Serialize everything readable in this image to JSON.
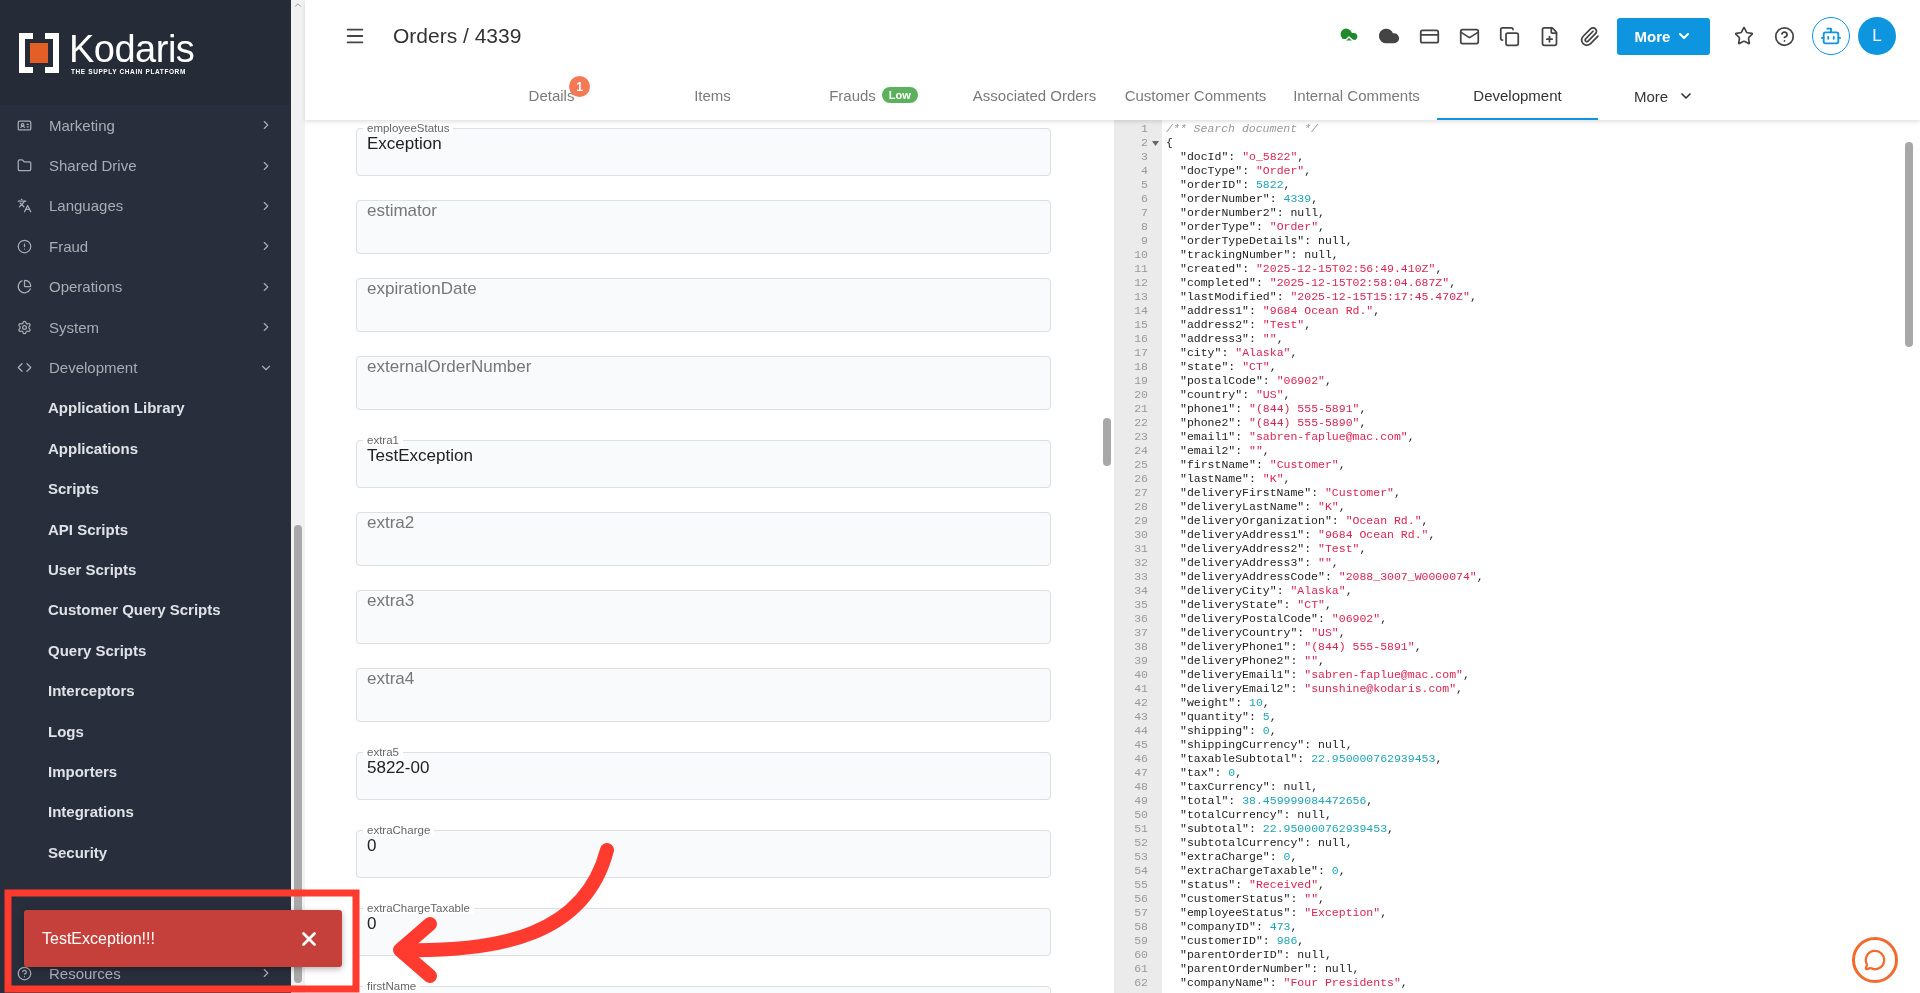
{
  "sidebar": {
    "logo": {
      "name": "Kodaris",
      "tagline": "THE SUPPLY CHAIN PLATFORM"
    },
    "items": [
      {
        "label": "Marketing",
        "expanded": false
      },
      {
        "label": "Shared Drive",
        "expanded": false
      },
      {
        "label": "Languages",
        "expanded": false
      },
      {
        "label": "Fraud",
        "expanded": false
      },
      {
        "label": "Operations",
        "expanded": false
      },
      {
        "label": "System",
        "expanded": false
      },
      {
        "label": "Development",
        "expanded": true,
        "children": [
          {
            "label": "Application Library"
          },
          {
            "label": "Applications"
          },
          {
            "label": "Scripts"
          },
          {
            "label": "API Scripts"
          },
          {
            "label": "User Scripts"
          },
          {
            "label": "Customer Query Scripts"
          },
          {
            "label": "Query Scripts"
          },
          {
            "label": "Interceptors"
          },
          {
            "label": "Logs"
          },
          {
            "label": "Importers"
          },
          {
            "label": "Integrations"
          },
          {
            "label": "Security"
          }
        ]
      },
      {
        "label": "Resources",
        "expanded": false
      }
    ]
  },
  "header": {
    "title": "Orders / 4339",
    "more_button": "More",
    "avatar": "L"
  },
  "tabs": [
    {
      "label": "Details",
      "selected": false,
      "badge": "1"
    },
    {
      "label": "Items",
      "selected": false
    },
    {
      "label": "Frauds",
      "selected": false,
      "tag": "Low"
    },
    {
      "label": "Associated Orders",
      "selected": false
    },
    {
      "label": "Customer Comments",
      "selected": false
    },
    {
      "label": "Internal Comments",
      "selected": false
    },
    {
      "label": "Development",
      "selected": true
    }
  ],
  "tabs_more": "More",
  "fields": [
    {
      "label": "employeeStatus",
      "value": "Exception"
    },
    {
      "placeholder": "estimator"
    },
    {
      "placeholder": "expirationDate"
    },
    {
      "placeholder": "externalOrderNumber"
    },
    {
      "label": "extra1",
      "value": "TestException"
    },
    {
      "placeholder": "extra2"
    },
    {
      "placeholder": "extra3"
    },
    {
      "placeholder": "extra4"
    },
    {
      "label": "extra5",
      "value": "5822-00"
    },
    {
      "label": "extraCharge",
      "value": "0"
    },
    {
      "label": "extraChargeTaxable",
      "value": "0"
    },
    {
      "label": "firstName"
    }
  ],
  "code_lines": [
    {
      "n": "1",
      "kind": "comment",
      "text": "/** Search document */"
    },
    {
      "n": "2",
      "kind": "brace",
      "text": "{",
      "foldable": true
    },
    {
      "n": "3",
      "kind": "pair",
      "text": "\"docId\": \"o_5822\","
    },
    {
      "n": "4",
      "kind": "pair",
      "text": "\"docType\": \"Order\","
    },
    {
      "n": "5",
      "kind": "pair",
      "text": "\"orderID\": 5822,"
    },
    {
      "n": "6",
      "kind": "pair",
      "text": "\"orderNumber\": 4339,"
    },
    {
      "n": "7",
      "kind": "pair",
      "text": "\"orderNumber2\": null,"
    },
    {
      "n": "8",
      "kind": "pair",
      "text": "\"orderType\": \"Order\","
    },
    {
      "n": "9",
      "kind": "pair",
      "text": "\"orderTypeDetails\": null,"
    },
    {
      "n": "10",
      "kind": "pair",
      "text": "\"trackingNumber\": null,"
    },
    {
      "n": "11",
      "kind": "pair",
      "text": "\"created\": \"2025-12-15T02:56:49.410Z\","
    },
    {
      "n": "12",
      "kind": "pair",
      "text": "\"completed\": \"2025-12-15T02:58:04.687Z\","
    },
    {
      "n": "13",
      "kind": "pair",
      "text": "\"lastModified\": \"2025-12-15T15:17:45.470Z\","
    },
    {
      "n": "14",
      "kind": "pair",
      "text": "\"address1\": \"9684 Ocean Rd.\","
    },
    {
      "n": "15",
      "kind": "pair",
      "text": "\"address2\": \"Test\","
    },
    {
      "n": "16",
      "kind": "pair",
      "text": "\"address3\": \"\","
    },
    {
      "n": "17",
      "kind": "pair",
      "text": "\"city\": \"Alaska\","
    },
    {
      "n": "18",
      "kind": "pair",
      "text": "\"state\": \"CT\","
    },
    {
      "n": "19",
      "kind": "pair",
      "text": "\"postalCode\": \"06902\","
    },
    {
      "n": "20",
      "kind": "pair",
      "text": "\"country\": \"US\","
    },
    {
      "n": "21",
      "kind": "pair",
      "text": "\"phone1\": \"(844) 555-5891\","
    },
    {
      "n": "22",
      "kind": "pair",
      "text": "\"phone2\": \"(844) 555-5890\","
    },
    {
      "n": "23",
      "kind": "pair",
      "text": "\"email1\": \"sabren-faplue@mac.com\","
    },
    {
      "n": "24",
      "kind": "pair",
      "text": "\"email2\": \"\","
    },
    {
      "n": "25",
      "kind": "pair",
      "text": "\"firstName\": \"Customer\","
    },
    {
      "n": "26",
      "kind": "pair",
      "text": "\"lastName\": \"K\","
    },
    {
      "n": "27",
      "kind": "pair",
      "text": "\"deliveryFirstName\": \"Customer\","
    },
    {
      "n": "28",
      "kind": "pair",
      "text": "\"deliveryLastName\": \"K\","
    },
    {
      "n": "29",
      "kind": "pair",
      "text": "\"deliveryOrganization\": \"Ocean Rd.\","
    },
    {
      "n": "30",
      "kind": "pair",
      "text": "\"deliveryAddress1\": \"9684 Ocean Rd.\","
    },
    {
      "n": "31",
      "kind": "pair",
      "text": "\"deliveryAddress2\": \"Test\","
    },
    {
      "n": "32",
      "kind": "pair",
      "text": "\"deliveryAddress3\": \"\","
    },
    {
      "n": "33",
      "kind": "pair",
      "text": "\"deliveryAddressCode\": \"2088_3007_W0000074\","
    },
    {
      "n": "34",
      "kind": "pair",
      "text": "\"deliveryCity\": \"Alaska\","
    },
    {
      "n": "35",
      "kind": "pair",
      "text": "\"deliveryState\": \"CT\","
    },
    {
      "n": "36",
      "kind": "pair",
      "text": "\"deliveryPostalCode\": \"06902\","
    },
    {
      "n": "37",
      "kind": "pair",
      "text": "\"deliveryCountry\": \"US\","
    },
    {
      "n": "38",
      "kind": "pair",
      "text": "\"deliveryPhone1\": \"(844) 555-5891\","
    },
    {
      "n": "39",
      "kind": "pair",
      "text": "\"deliveryPhone2\": \"\","
    },
    {
      "n": "40",
      "kind": "pair",
      "text": "\"deliveryEmail1\": \"sabren-faplue@mac.com\","
    },
    {
      "n": "41",
      "kind": "pair",
      "text": "\"deliveryEmail2\": \"sunshine@kodaris.com\","
    },
    {
      "n": "42",
      "kind": "pair",
      "text": "\"weight\": 10,"
    },
    {
      "n": "43",
      "kind": "pair",
      "text": "\"quantity\": 5,"
    },
    {
      "n": "44",
      "kind": "pair",
      "text": "\"shipping\": 0,"
    },
    {
      "n": "45",
      "kind": "pair",
      "text": "\"shippingCurrency\": null,"
    },
    {
      "n": "46",
      "kind": "pair",
      "text": "\"taxableSubtotal\": 22.950000762939453,"
    },
    {
      "n": "47",
      "kind": "pair",
      "text": "\"tax\": 0,"
    },
    {
      "n": "48",
      "kind": "pair",
      "text": "\"taxCurrency\": null,"
    },
    {
      "n": "49",
      "kind": "pair",
      "text": "\"total\": 38.459999084472656,"
    },
    {
      "n": "50",
      "kind": "pair",
      "text": "\"totalCurrency\": null,"
    },
    {
      "n": "51",
      "kind": "pair",
      "text": "\"subtotal\": 22.950000762939453,"
    },
    {
      "n": "52",
      "kind": "pair",
      "text": "\"subtotalCurrency\": null,"
    },
    {
      "n": "53",
      "kind": "pair",
      "text": "\"extraCharge\": 0,"
    },
    {
      "n": "54",
      "kind": "pair",
      "text": "\"extraChargeTaxable\": 0,"
    },
    {
      "n": "55",
      "kind": "pair",
      "text": "\"status\": \"Received\","
    },
    {
      "n": "56",
      "kind": "pair",
      "text": "\"customerStatus\": \"\","
    },
    {
      "n": "57",
      "kind": "pair",
      "text": "\"employeeStatus\": \"Exception\","
    },
    {
      "n": "58",
      "kind": "pair",
      "text": "\"companyID\": 473,"
    },
    {
      "n": "59",
      "kind": "pair",
      "text": "\"customerID\": 986,"
    },
    {
      "n": "60",
      "kind": "pair",
      "text": "\"parentOrderID\": null,"
    },
    {
      "n": "61",
      "kind": "pair",
      "text": "\"parentOrderNumber\": null,"
    },
    {
      "n": "62",
      "kind": "pair",
      "text": "\"companyName\": \"Four Presidents\","
    }
  ],
  "toast": {
    "message": "TestException!!!"
  }
}
